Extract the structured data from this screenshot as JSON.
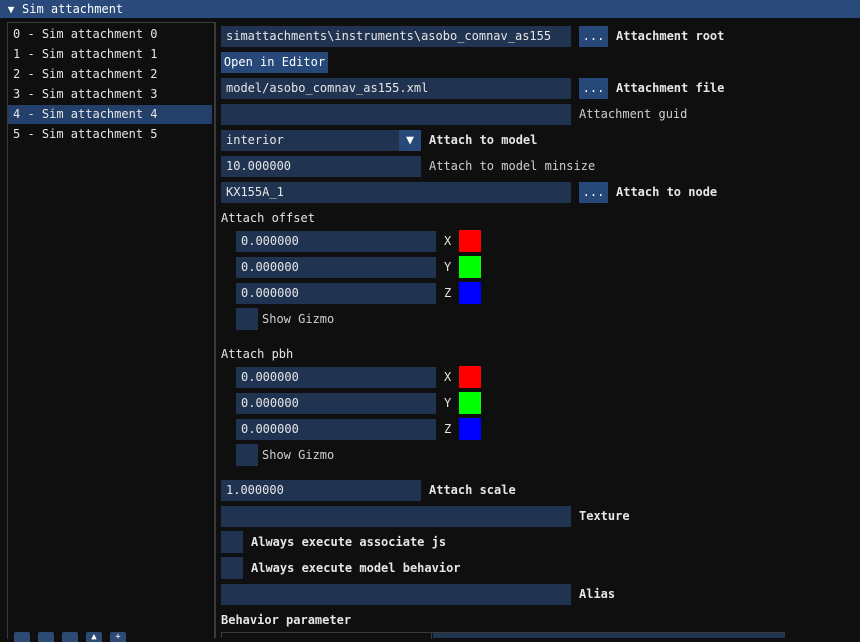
{
  "header": {
    "title": "Sim attachment"
  },
  "list": {
    "items": [
      "0 - Sim attachment 0",
      "1 - Sim attachment 1",
      "2 - Sim attachment 2",
      "3 - Sim attachment 3",
      "4 - Sim attachment 4",
      "5 - Sim attachment 5"
    ],
    "selected_index": 4
  },
  "form": {
    "attachment_root": {
      "value": "simattachments\\instruments\\asobo_comnav_as155",
      "browse": "...",
      "label": "Attachment root"
    },
    "open_in_editor": "Open in Editor",
    "attachment_file": {
      "value": "model/asobo_comnav_as155.xml",
      "browse": "...",
      "label": "Attachment file"
    },
    "attachment_guid": {
      "value": "",
      "label": "Attachment guid"
    },
    "attach_to_model": {
      "value": "interior",
      "label": "Attach to model"
    },
    "attach_to_model_minsize": {
      "value": "10.000000",
      "label": "Attach to model minsize"
    },
    "attach_to_node": {
      "value": "KX155A_1",
      "browse": "...",
      "label": "Attach to node"
    },
    "attach_offset": {
      "heading": "Attach offset",
      "x": "0.000000",
      "y": "0.000000",
      "z": "0.000000",
      "x_label": "X",
      "y_label": "Y",
      "z_label": "Z",
      "show_gizmo": "Show Gizmo"
    },
    "attach_pbh": {
      "heading": "Attach pbh",
      "x": "0.000000",
      "y": "0.000000",
      "z": "0.000000",
      "x_label": "X",
      "y_label": "Y",
      "z_label": "Z",
      "show_gizmo": "Show Gizmo"
    },
    "attach_scale": {
      "value": "1.000000",
      "label": "Attach scale"
    },
    "texture": {
      "value": "",
      "label": "Texture"
    },
    "always_execute_js": "Always execute associate js",
    "always_execute_behavior": "Always execute model behavior",
    "alias": {
      "value": "",
      "label": "Alias"
    },
    "behavior_parameter": "Behavior parameter"
  },
  "colors": {
    "x": "#ff0000",
    "y": "#00ff00",
    "z": "#0000ff",
    "accent": "#294a7a"
  }
}
